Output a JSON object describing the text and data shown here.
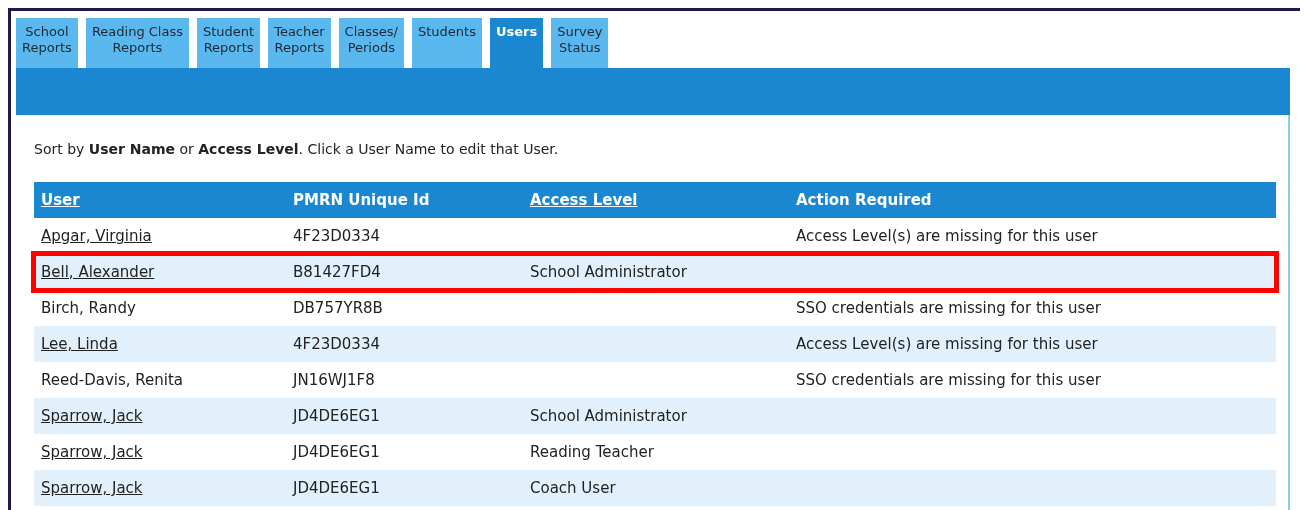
{
  "tabs": [
    {
      "label": "School\nReports",
      "selected": false
    },
    {
      "label": "Reading Class\nReports",
      "selected": false
    },
    {
      "label": "Student\nReports",
      "selected": false
    },
    {
      "label": "Teacher\nReports",
      "selected": false
    },
    {
      "label": "Classes/\nPeriods",
      "selected": false
    },
    {
      "label": "Students",
      "selected": false
    },
    {
      "label": "Users",
      "selected": true
    },
    {
      "label": "Survey\nStatus",
      "selected": false
    }
  ],
  "instructions": "Sort by **User Name** or **Access Level**. Click a User Name to edit that User.",
  "table": {
    "columns": [
      {
        "label": "User",
        "sortable": true
      },
      {
        "label": "PMRN Unique Id",
        "sortable": false
      },
      {
        "label": "Access Level",
        "sortable": true
      },
      {
        "label": "Action Required",
        "sortable": false
      }
    ],
    "rows": [
      {
        "user": "Apgar, Virginia",
        "link": true,
        "id": "4F23D0334",
        "access_level": "",
        "action": "Access Level(s) are missing for this user",
        "highlighted": false
      },
      {
        "user": "Bell, Alexander",
        "link": true,
        "id": "B81427FD4",
        "access_level": "School Administrator",
        "action": "",
        "highlighted": true
      },
      {
        "user": "Birch, Randy",
        "link": false,
        "id": "DB757YR8B",
        "access_level": "",
        "action": "SSO credentials are missing for this user",
        "highlighted": false
      },
      {
        "user": "Lee, Linda",
        "link": true,
        "id": "4F23D0334",
        "access_level": "",
        "action": "Access Level(s) are missing for this user",
        "highlighted": false
      },
      {
        "user": "Reed-Davis, Renita",
        "link": false,
        "id": "JN16WJ1F8",
        "access_level": "",
        "action": "SSO credentials are missing for this user",
        "highlighted": false
      },
      {
        "user": "Sparrow, Jack",
        "link": true,
        "id": "JD4DE6EG1",
        "access_level": "School Administrator",
        "action": "",
        "highlighted": false
      },
      {
        "user": "Sparrow, Jack",
        "link": true,
        "id": "JD4DE6EG1",
        "access_level": "Reading Teacher",
        "action": "",
        "highlighted": false
      },
      {
        "user": "Sparrow, Jack",
        "link": true,
        "id": "JD4DE6EG1",
        "access_level": "Coach User",
        "action": "",
        "highlighted": false
      }
    ]
  }
}
